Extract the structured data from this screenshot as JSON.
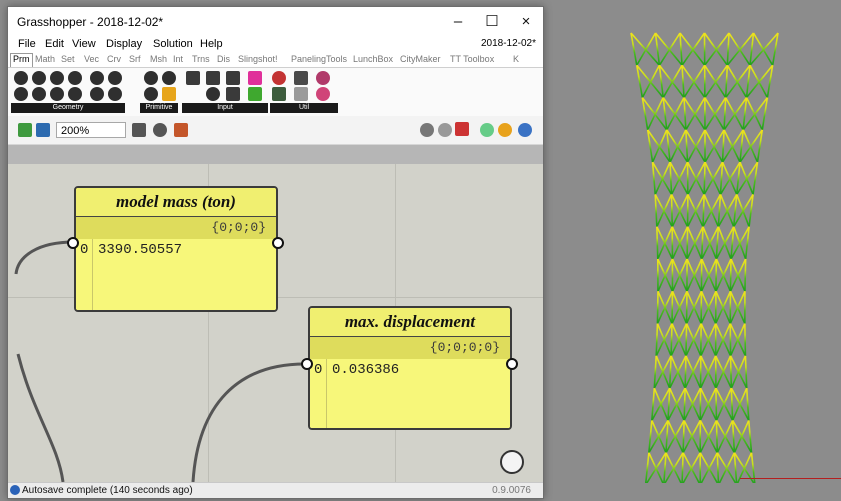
{
  "window": {
    "title": "Grasshopper - 2018-12-02*",
    "minimize": "–",
    "maximize": "☐",
    "close": "×"
  },
  "menubar": {
    "items": [
      "File",
      "Edit",
      "View",
      "Display",
      "Solution",
      "Help"
    ],
    "date": "2018-12-02*"
  },
  "tabs": [
    "Prm",
    "Math",
    "Set",
    "Vec",
    "Crv",
    "Srf",
    "Msh",
    "Int",
    "Trns",
    "Dis",
    "Slingshot!",
    "PanelingTools",
    "LunchBox",
    "CityMaker",
    "TT Toolbox",
    "K"
  ],
  "ribbon": {
    "groups": [
      "Geometry",
      "Primitive",
      "Input",
      "Util"
    ]
  },
  "toolbar": {
    "zoom": "200%"
  },
  "panels": {
    "mass": {
      "title": "model mass (ton)",
      "path": "{0;0;0}",
      "index": "0",
      "value": "3390.50557"
    },
    "disp": {
      "title": "max. displacement",
      "path": "{0;0;0;0}",
      "index": "0",
      "value": "0.036386"
    }
  },
  "status": {
    "message": "Autosave complete (140 seconds ago)",
    "version": "0.9.0076"
  },
  "colors": {
    "panel": "#f7f77a",
    "canvas": "#d2d2ca",
    "viewport": "#8c8c8c",
    "structure_low": "#1fa81f",
    "structure_high": "#f5e21c"
  }
}
